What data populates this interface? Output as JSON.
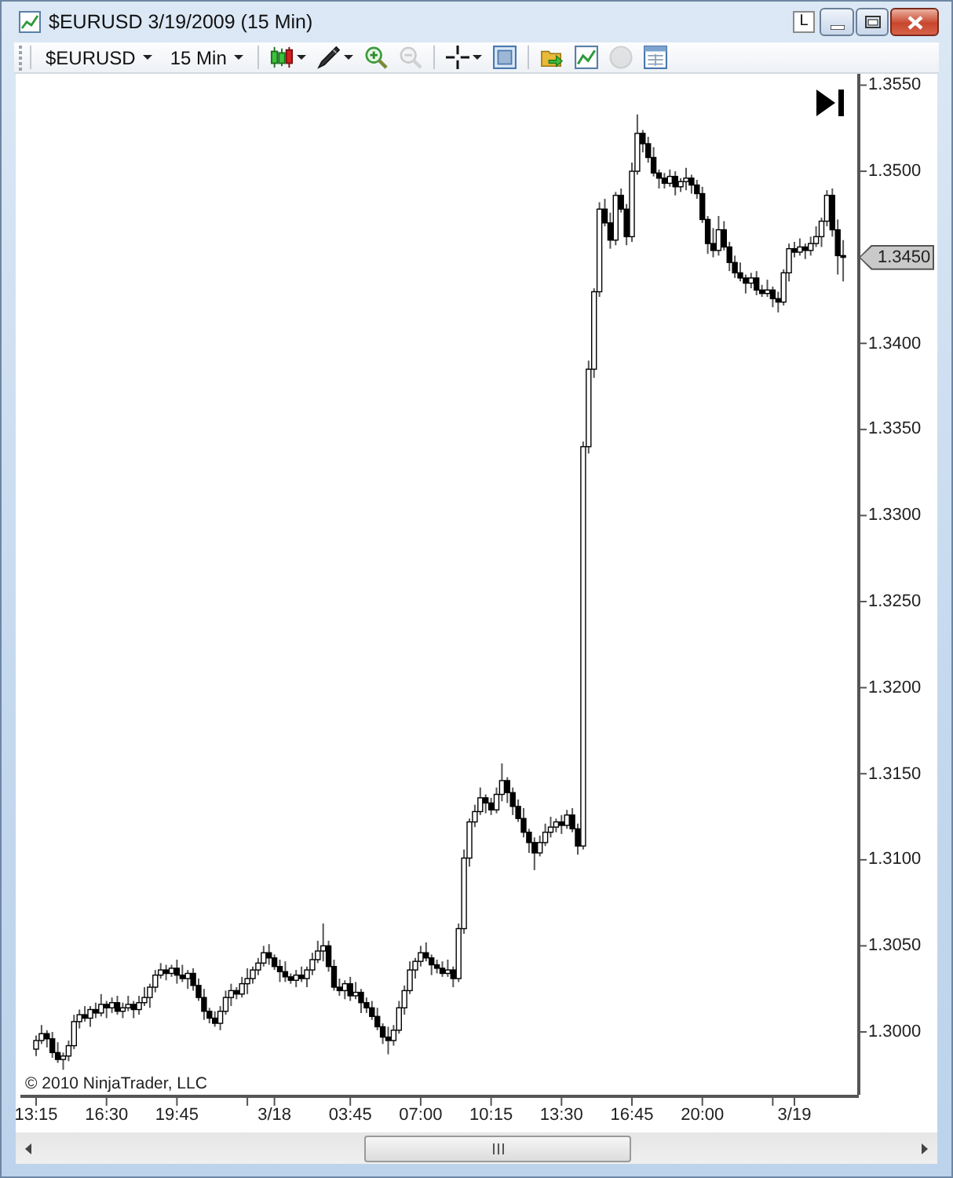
{
  "window": {
    "title": "$EURUSD 3/19/2009 (15 Min)",
    "controls": [
      {
        "kind": "layout",
        "label": "L"
      },
      {
        "kind": "minimize"
      },
      {
        "kind": "maximize"
      },
      {
        "kind": "close"
      }
    ]
  },
  "toolbar": {
    "menus": [
      {
        "label": "$EURUSD"
      },
      {
        "label": "15 Min"
      }
    ],
    "tools": [
      {
        "kind": "chart-style",
        "dropdown": true,
        "disabled": false
      },
      {
        "kind": "drawing-tool",
        "dropdown": true,
        "disabled": false
      },
      {
        "kind": "zoom-in",
        "dropdown": false,
        "disabled": false
      },
      {
        "kind": "zoom-out",
        "dropdown": false,
        "disabled": true
      },
      {
        "kind": "separator"
      },
      {
        "kind": "crosshair",
        "dropdown": true,
        "disabled": false
      },
      {
        "kind": "properties",
        "dropdown": false,
        "disabled": false
      },
      {
        "kind": "separator"
      },
      {
        "kind": "folder",
        "dropdown": false,
        "disabled": false
      },
      {
        "kind": "chart",
        "dropdown": false,
        "disabled": false
      },
      {
        "kind": "circle",
        "dropdown": false,
        "disabled": true
      },
      {
        "kind": "panel",
        "dropdown": false,
        "disabled": false
      }
    ]
  },
  "chart": {
    "copyright": "© 2010 NinjaTrader, LLC",
    "chart_data": {
      "type": "candlestick",
      "categories": [
        "13:15",
        null,
        null,
        null,
        null,
        null,
        null,
        null,
        null,
        null,
        null,
        null,
        null,
        "16:30",
        null,
        null,
        null,
        null,
        null,
        null,
        null,
        null,
        null,
        null,
        null,
        null,
        "19:45",
        null,
        null,
        null,
        null,
        null,
        null,
        null,
        null,
        null,
        null,
        null,
        null,
        null,
        null,
        null,
        null,
        null,
        "3/18",
        null,
        null,
        null,
        null,
        null,
        null,
        null,
        null,
        null,
        null,
        null,
        null,
        null,
        "03:45",
        null,
        null,
        null,
        null,
        null,
        null,
        null,
        null,
        null,
        null,
        null,
        null,
        "07:00",
        null,
        null,
        null,
        null,
        null,
        null,
        null,
        null,
        null,
        null,
        null,
        null,
        "10:15",
        null,
        null,
        null,
        null,
        null,
        null,
        null,
        null,
        null,
        null,
        null,
        null,
        "13:30",
        null,
        null,
        null,
        null,
        null,
        null,
        null,
        null,
        null,
        null,
        null,
        null,
        "16:45",
        null,
        null,
        null,
        null,
        null,
        null,
        null,
        null,
        null,
        null,
        null,
        null,
        "20:00",
        null,
        null,
        null,
        null,
        null,
        null,
        null,
        null,
        null,
        null,
        null,
        null,
        null,
        null,
        null,
        null,
        "3/19",
        null,
        null,
        null,
        null,
        null,
        null,
        null,
        null,
        null
      ],
      "ohlc": [
        [
          1.299,
          1.2998,
          1.2986,
          1.2995
        ],
        [
          1.2995,
          1.3004,
          1.2993,
          1.2999
        ],
        [
          1.2999,
          1.3001,
          1.2991,
          1.2996
        ],
        [
          1.2996,
          1.3,
          1.2985,
          1.2988
        ],
        [
          1.2988,
          1.2994,
          1.2982,
          1.2984
        ],
        [
          1.2984,
          1.2988,
          1.2978,
          1.2986
        ],
        [
          1.2986,
          1.2995,
          1.2983,
          1.2992
        ],
        [
          1.2992,
          1.301,
          1.299,
          1.3006
        ],
        [
          1.3006,
          1.3013,
          1.3002,
          1.301
        ],
        [
          1.301,
          1.3015,
          1.3006,
          1.3008
        ],
        [
          1.3008,
          1.3015,
          1.3003,
          1.3013
        ],
        [
          1.3013,
          1.3017,
          1.3008,
          1.3011
        ],
        [
          1.3011,
          1.3022,
          1.3009,
          1.3016
        ],
        [
          1.3016,
          1.3018,
          1.3008,
          1.3014
        ],
        [
          1.3014,
          1.302,
          1.3011,
          1.3017
        ],
        [
          1.3017,
          1.3021,
          1.301,
          1.3012
        ],
        [
          1.3012,
          1.3017,
          1.3008,
          1.3014
        ],
        [
          1.3014,
          1.3021,
          1.3012,
          1.3016
        ],
        [
          1.3016,
          1.3018,
          1.3008,
          1.3013
        ],
        [
          1.3013,
          1.3021,
          1.301,
          1.3017
        ],
        [
          1.3017,
          1.3026,
          1.3015,
          1.302
        ],
        [
          1.302,
          1.3028,
          1.3014,
          1.3026
        ],
        [
          1.3026,
          1.3036,
          1.3023,
          1.3033
        ],
        [
          1.3033,
          1.304,
          1.3031,
          1.3036
        ],
        [
          1.3036,
          1.3039,
          1.303,
          1.3034
        ],
        [
          1.3034,
          1.3039,
          1.3032,
          1.3037
        ],
        [
          1.3037,
          1.3042,
          1.3028,
          1.3033
        ],
        [
          1.3033,
          1.3039,
          1.3029,
          1.3031
        ],
        [
          1.3031,
          1.3036,
          1.3025,
          1.3034
        ],
        [
          1.3034,
          1.3037,
          1.3024,
          1.3027
        ],
        [
          1.3027,
          1.3031,
          1.3018,
          1.302
        ],
        [
          1.302,
          1.3025,
          1.3007,
          1.3012
        ],
        [
          1.3012,
          1.3014,
          1.3005,
          1.3008
        ],
        [
          1.3008,
          1.3012,
          1.3003,
          1.3005
        ],
        [
          1.3005,
          1.3015,
          1.3001,
          1.3012
        ],
        [
          1.3012,
          1.3024,
          1.301,
          1.302
        ],
        [
          1.302,
          1.3028,
          1.3015,
          1.3024
        ],
        [
          1.3024,
          1.3026,
          1.3019,
          1.3022
        ],
        [
          1.3022,
          1.3032,
          1.302,
          1.3028
        ],
        [
          1.3028,
          1.3037,
          1.3022,
          1.3031
        ],
        [
          1.3031,
          1.3038,
          1.3028,
          1.3036
        ],
        [
          1.3036,
          1.3043,
          1.3033,
          1.304
        ],
        [
          1.304,
          1.305,
          1.3038,
          1.3046
        ],
        [
          1.3046,
          1.3051,
          1.3039,
          1.3043
        ],
        [
          1.3043,
          1.3045,
          1.3036,
          1.3038
        ],
        [
          1.3038,
          1.3042,
          1.3029,
          1.3035
        ],
        [
          1.3035,
          1.3041,
          1.3029,
          1.3032
        ],
        [
          1.3032,
          1.3034,
          1.3028,
          1.303
        ],
        [
          1.303,
          1.3036,
          1.3026,
          1.3033
        ],
        [
          1.3033,
          1.3038,
          1.3029,
          1.3031
        ],
        [
          1.3031,
          1.3038,
          1.3026,
          1.3036
        ],
        [
          1.3036,
          1.3046,
          1.3033,
          1.3042
        ],
        [
          1.3042,
          1.3053,
          1.304,
          1.3047
        ],
        [
          1.3047,
          1.3063,
          1.3041,
          1.305
        ],
        [
          1.305,
          1.3053,
          1.3035,
          1.3038
        ],
        [
          1.3038,
          1.3042,
          1.3024,
          1.3026
        ],
        [
          1.3026,
          1.3031,
          1.3021,
          1.3024
        ],
        [
          1.3024,
          1.303,
          1.3019,
          1.3028
        ],
        [
          1.3028,
          1.3032,
          1.3018,
          1.3021
        ],
        [
          1.3021,
          1.3029,
          1.3019,
          1.3023
        ],
        [
          1.3023,
          1.3025,
          1.3011,
          1.3017
        ],
        [
          1.3017,
          1.302,
          1.3011,
          1.3014
        ],
        [
          1.3014,
          1.3018,
          1.3007,
          1.3009
        ],
        [
          1.3009,
          1.3014,
          1.3001,
          1.3003
        ],
        [
          1.3003,
          1.3005,
          1.2993,
          1.2997
        ],
        [
          1.2997,
          1.3003,
          1.2987,
          1.2995
        ],
        [
          1.2995,
          1.3004,
          1.2992,
          1.3001
        ],
        [
          1.3001,
          1.3018,
          1.2999,
          1.3014
        ],
        [
          1.3014,
          1.3027,
          1.301,
          1.3024
        ],
        [
          1.3024,
          1.3041,
          1.3022,
          1.3036
        ],
        [
          1.3036,
          1.3043,
          1.3031,
          1.3041
        ],
        [
          1.3041,
          1.305,
          1.3038,
          1.3046
        ],
        [
          1.3046,
          1.3052,
          1.3041,
          1.3043
        ],
        [
          1.3043,
          1.3045,
          1.3033,
          1.3039
        ],
        [
          1.3039,
          1.3042,
          1.3034,
          1.3037
        ],
        [
          1.3037,
          1.3041,
          1.3032,
          1.3034
        ],
        [
          1.3034,
          1.3042,
          1.3032,
          1.3036
        ],
        [
          1.3036,
          1.3038,
          1.3026,
          1.3031
        ],
        [
          1.3031,
          1.3063,
          1.3029,
          1.306
        ],
        [
          1.306,
          1.3106,
          1.3057,
          1.3101
        ],
        [
          1.3101,
          1.3124,
          1.3096,
          1.3122
        ],
        [
          1.3122,
          1.3132,
          1.3119,
          1.3128
        ],
        [
          1.3128,
          1.3142,
          1.3126,
          1.3136
        ],
        [
          1.3136,
          1.3138,
          1.3127,
          1.3133
        ],
        [
          1.3133,
          1.3136,
          1.3126,
          1.3129
        ],
        [
          1.3129,
          1.3142,
          1.3127,
          1.3138
        ],
        [
          1.3138,
          1.3156,
          1.3134,
          1.3146
        ],
        [
          1.3146,
          1.3148,
          1.3133,
          1.3139
        ],
        [
          1.3139,
          1.3142,
          1.3126,
          1.3131
        ],
        [
          1.3131,
          1.3135,
          1.3122,
          1.3124
        ],
        [
          1.3124,
          1.313,
          1.3113,
          1.3116
        ],
        [
          1.3116,
          1.3118,
          1.3104,
          1.311
        ],
        [
          1.311,
          1.3113,
          1.3094,
          1.3104
        ],
        [
          1.3104,
          1.3114,
          1.3102,
          1.311
        ],
        [
          1.311,
          1.3121,
          1.3108,
          1.3116
        ],
        [
          1.3116,
          1.3125,
          1.3113,
          1.3119
        ],
        [
          1.3119,
          1.3124,
          1.3116,
          1.3122
        ],
        [
          1.3122,
          1.3126,
          1.3115,
          1.312
        ],
        [
          1.312,
          1.3129,
          1.3118,
          1.3126
        ],
        [
          1.3126,
          1.313,
          1.3116,
          1.3118
        ],
        [
          1.3118,
          1.3121,
          1.3103,
          1.3108
        ],
        [
          1.3108,
          1.3343,
          1.3106,
          1.334
        ],
        [
          1.334,
          1.339,
          1.3336,
          1.3385
        ],
        [
          1.3385,
          1.3432,
          1.338,
          1.343
        ],
        [
          1.343,
          1.3482,
          1.3427,
          1.3478
        ],
        [
          1.3478,
          1.3484,
          1.3468,
          1.347
        ],
        [
          1.347,
          1.3476,
          1.3455,
          1.346
        ],
        [
          1.346,
          1.3488,
          1.3457,
          1.3486
        ],
        [
          1.3486,
          1.349,
          1.3476,
          1.3478
        ],
        [
          1.3478,
          1.3481,
          1.3457,
          1.3462
        ],
        [
          1.3462,
          1.3505,
          1.3459,
          1.35
        ],
        [
          1.35,
          1.3533,
          1.3498,
          1.3522
        ],
        [
          1.3522,
          1.3524,
          1.3511,
          1.3516
        ],
        [
          1.3516,
          1.352,
          1.3505,
          1.3508
        ],
        [
          1.3508,
          1.3514,
          1.3497,
          1.3499
        ],
        [
          1.3499,
          1.3501,
          1.349,
          1.3496
        ],
        [
          1.3496,
          1.3499,
          1.349,
          1.3493
        ],
        [
          1.3493,
          1.3501,
          1.3491,
          1.3497
        ],
        [
          1.3497,
          1.35,
          1.3486,
          1.3491
        ],
        [
          1.3491,
          1.3496,
          1.3488,
          1.3494
        ],
        [
          1.3494,
          1.3502,
          1.3489,
          1.3496
        ],
        [
          1.3496,
          1.3498,
          1.3487,
          1.3492
        ],
        [
          1.3492,
          1.3495,
          1.3484,
          1.3487
        ],
        [
          1.3487,
          1.3491,
          1.347,
          1.3472
        ],
        [
          1.3472,
          1.3474,
          1.3452,
          1.3458
        ],
        [
          1.3458,
          1.3467,
          1.345,
          1.3454
        ],
        [
          1.3454,
          1.3474,
          1.3451,
          1.3466
        ],
        [
          1.3466,
          1.3471,
          1.3454,
          1.3456
        ],
        [
          1.3456,
          1.3459,
          1.3442,
          1.3447
        ],
        [
          1.3447,
          1.3451,
          1.3438,
          1.3441
        ],
        [
          1.3441,
          1.3447,
          1.3436,
          1.3438
        ],
        [
          1.3438,
          1.344,
          1.3429,
          1.3435
        ],
        [
          1.3435,
          1.3441,
          1.3432,
          1.3438
        ],
        [
          1.3438,
          1.3442,
          1.3428,
          1.3431
        ],
        [
          1.3431,
          1.3434,
          1.3427,
          1.3429
        ],
        [
          1.3429,
          1.3437,
          1.3427,
          1.3431
        ],
        [
          1.3431,
          1.3433,
          1.3421,
          1.3426
        ],
        [
          1.3426,
          1.343,
          1.3418,
          1.3424
        ],
        [
          1.3424,
          1.3443,
          1.3422,
          1.3441
        ],
        [
          1.3441,
          1.3458,
          1.3436,
          1.3455
        ],
        [
          1.3455,
          1.3459,
          1.345,
          1.3453
        ],
        [
          1.3453,
          1.3461,
          1.3451,
          1.3456
        ],
        [
          1.3456,
          1.3458,
          1.3449,
          1.3454
        ],
        [
          1.3454,
          1.3462,
          1.3451,
          1.3458
        ],
        [
          1.3458,
          1.3468,
          1.3456,
          1.3462
        ],
        [
          1.3462,
          1.3473,
          1.3456,
          1.3471
        ],
        [
          1.3471,
          1.3489,
          1.3468,
          1.3486
        ],
        [
          1.3486,
          1.349,
          1.3462,
          1.3466
        ],
        [
          1.3466,
          1.3472,
          1.344,
          1.3451
        ],
        [
          1.3451,
          1.346,
          1.3436,
          1.345
        ]
      ],
      "ylim": [
        1.29635,
        1.35566
      ],
      "yticks": [
        {
          "value": 1.355,
          "label": "1.3550"
        },
        {
          "value": 1.35,
          "label": "1.3500"
        },
        {
          "value": 1.34,
          "label": "1.3400"
        },
        {
          "value": 1.335,
          "label": "1.3350"
        },
        {
          "value": 1.33,
          "label": "1.3300"
        },
        {
          "value": 1.325,
          "label": "1.3250"
        },
        {
          "value": 1.32,
          "label": "1.3200"
        },
        {
          "value": 1.315,
          "label": "1.3150"
        },
        {
          "value": 1.31,
          "label": "1.3100"
        },
        {
          "value": 1.305,
          "label": "1.3050"
        },
        {
          "value": 1.3,
          "label": "1.3000"
        }
      ],
      "annotations": [
        "1.3450"
      ]
    }
  }
}
